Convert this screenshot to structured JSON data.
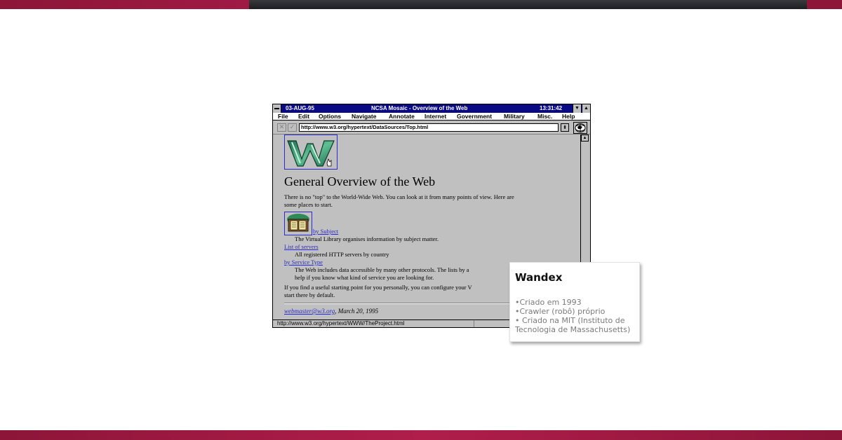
{
  "window": {
    "date": "03-AUG-95",
    "title": "NCSA Mosaic - Overview of the Web",
    "time": "13:31:42"
  },
  "menu": [
    "File",
    "Edit",
    "Options",
    "Navigate",
    "Annotate",
    "Internet",
    "Government",
    "Military",
    "Misc.",
    "Help"
  ],
  "toolbar": {
    "url": "http://www.w3.org/hypertext/DataSources/Top.html"
  },
  "page": {
    "heading": "General Overview of the Web",
    "intro_line1": "There is no \"top\" to the World-Wide Web.  You can look at it from many points of view.  Here are",
    "intro_line2": "some places to start.",
    "links": [
      {
        "label": "by Subject",
        "desc": "The Virtual Library organises information by subject matter."
      },
      {
        "label": "List of servers",
        "desc": "All registered HTTP servers by country"
      },
      {
        "label": "by Service Type",
        "desc": "The Web includes data accessible by many other protocols. The lists by a"
      }
    ],
    "service_desc2": "help if you know what kind of service you are looking for.",
    "start_line1": "If you find a useful starting point for you personally, you can configure your V",
    "start_line2": "start there by default.",
    "signature_link": "webmaster@w3.org",
    "signature_date": ", March 20, 1995"
  },
  "status": "http://www.w3.org/hypertext/WWW/TheProject.html",
  "card": {
    "title": "Wandex",
    "lines": [
      "•Criado em 1993",
      "•Crawler (robô) próprio",
      "• Criado na MIT (Instituto de",
      "Tecnologia de Massachusetts)"
    ]
  },
  "colors": {
    "titlebar": "#0a0a84",
    "link": "#2a2acf",
    "brand_band": "#8c1538"
  }
}
